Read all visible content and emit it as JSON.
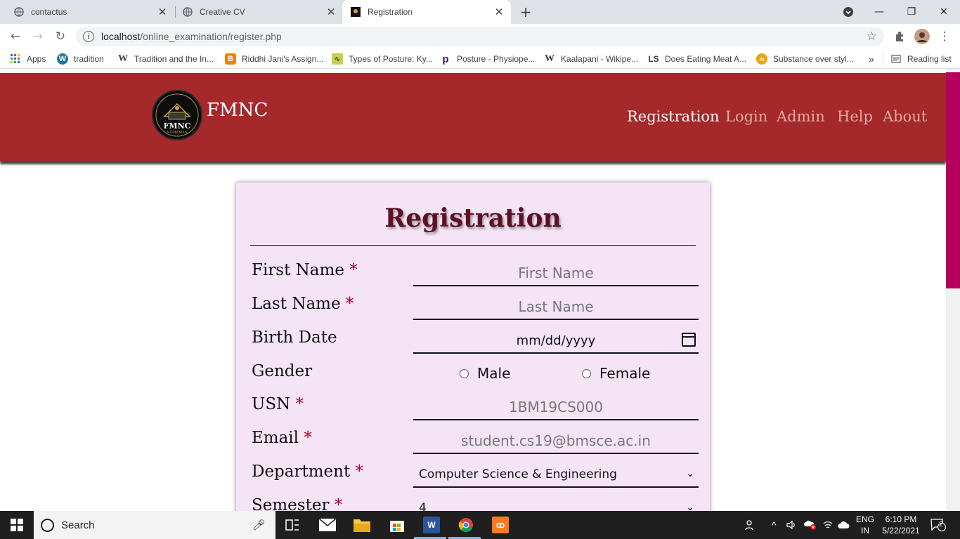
{
  "tabs": [
    {
      "title": "contactus",
      "icon": "globe-icon"
    },
    {
      "title": "Creative CV",
      "icon": "globe-icon"
    },
    {
      "title": "Registration",
      "icon": "fmnc-favicon"
    }
  ],
  "address_bar": {
    "host": "localhost",
    "path": "/online_examination/register.php"
  },
  "bookmarks": [
    "Apps",
    "tradition",
    "Tradition and the In...",
    "Riddhi Jani's Assign...",
    "Types of Posture: Ky...",
    "Posture - Physiope...",
    "Kaalapani - Wikipe...",
    "Does Eating Meat A...",
    "Substance over styl..."
  ],
  "bookmarks_more": "»",
  "reading_list": "Reading list",
  "site": {
    "brand": "FMNC",
    "logo_text": "FMNC",
    "logo_subtext": "AUTONOMOUS",
    "nav": [
      "Registration",
      "Login",
      "Admin",
      "Help",
      "About"
    ],
    "active_nav": "Registration",
    "header_color": "#a5282b"
  },
  "form": {
    "title": "Registration",
    "required_mark": "*",
    "first_name": {
      "label": "First Name",
      "placeholder": "First Name"
    },
    "last_name": {
      "label": "Last Name",
      "placeholder": "Last Name"
    },
    "birth_date": {
      "label": "Birth Date",
      "placeholder": "mm/dd/yyyy"
    },
    "gender": {
      "label": "Gender",
      "options": [
        "Male",
        "Female"
      ]
    },
    "usn": {
      "label": "USN",
      "placeholder": "1BM19CS000"
    },
    "email": {
      "label": "Email",
      "placeholder": "student.cs19@bmsce.ac.in"
    },
    "department": {
      "label": "Department",
      "value": "Computer Science & Engineering"
    },
    "semester": {
      "label": "Semester",
      "value": "4"
    }
  },
  "taskbar": {
    "search_placeholder": "Search",
    "language": "ENG",
    "region": "IN",
    "time": "6:10 PM",
    "date": "5/22/2021",
    "notifications": "2"
  }
}
